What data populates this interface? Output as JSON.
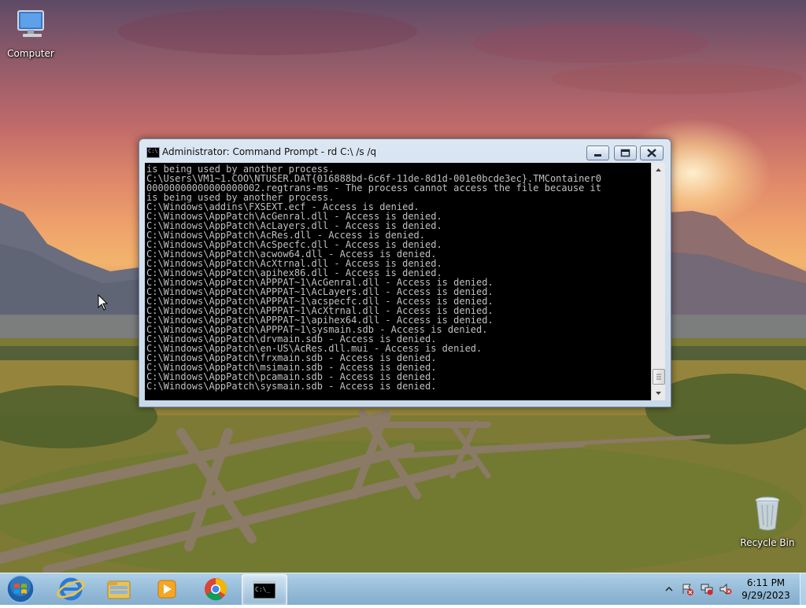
{
  "desktop": {
    "icons": [
      {
        "label": "Computer",
        "icon": "computer-icon"
      },
      {
        "label": "Recycle Bin",
        "icon": "recycle-bin-icon"
      }
    ]
  },
  "window": {
    "title": "Administrator:  Command Prompt - rd  C:\\ /s /q",
    "console_lines": [
      "is being used by another process.",
      "C:\\Users\\VM1~1.COO\\NTUSER.DAT{016888bd-6c6f-11de-8d1d-001e0bcde3ec}.TMContainer0",
      "00000000000000000002.regtrans-ms - The process cannot access the file because it",
      "is being used by another process.",
      "C:\\Windows\\addins\\FXSEXT.ecf - Access is denied.",
      "C:\\Windows\\AppPatch\\AcGenral.dll - Access is denied.",
      "C:\\Windows\\AppPatch\\AcLayers.dll - Access is denied.",
      "C:\\Windows\\AppPatch\\AcRes.dll - Access is denied.",
      "C:\\Windows\\AppPatch\\AcSpecfc.dll - Access is denied.",
      "C:\\Windows\\AppPatch\\acwow64.dll - Access is denied.",
      "C:\\Windows\\AppPatch\\AcXtrnal.dll - Access is denied.",
      "C:\\Windows\\AppPatch\\apihex86.dll - Access is denied.",
      "C:\\Windows\\AppPatch\\APPPAT~1\\AcGenral.dll - Access is denied.",
      "C:\\Windows\\AppPatch\\APPPAT~1\\AcLayers.dll - Access is denied.",
      "C:\\Windows\\AppPatch\\APPPAT~1\\acspecfc.dll - Access is denied.",
      "C:\\Windows\\AppPatch\\APPPAT~1\\AcXtrnal.dll - Access is denied.",
      "C:\\Windows\\AppPatch\\APPPAT~1\\apihex64.dll - Access is denied.",
      "C:\\Windows\\AppPatch\\APPPAT~1\\sysmain.sdb - Access is denied.",
      "C:\\Windows\\AppPatch\\drvmain.sdb - Access is denied.",
      "C:\\Windows\\AppPatch\\en-US\\AcRes.dll.mui - Access is denied.",
      "C:\\Windows\\AppPatch\\frxmain.sdb - Access is denied.",
      "C:\\Windows\\AppPatch\\msimain.sdb - Access is denied.",
      "C:\\Windows\\AppPatch\\pcamain.sdb - Access is denied.",
      "C:\\Windows\\AppPatch\\sysmain.sdb - Access is denied."
    ],
    "console_text_color": "#c0c0c0",
    "console_bg_color": "#000000"
  },
  "taskbar": {
    "buttons": [
      {
        "icon": "start-orb-icon"
      },
      {
        "icon": "internet-explorer-icon"
      },
      {
        "icon": "file-explorer-icon"
      },
      {
        "icon": "media-player-icon"
      },
      {
        "icon": "chrome-icon"
      },
      {
        "icon": "command-prompt-icon",
        "active": true,
        "glyph": "C:\\_"
      }
    ],
    "tray": {
      "icons": [
        "show-hidden-icons-icon",
        "action-center-icon",
        "network-icon",
        "volume-muted-icon"
      ],
      "time": "6:11 PM",
      "date": "9/29/2023"
    }
  },
  "colors": {
    "taskbar": "#9bbfdc",
    "window_frame": "#cddcee"
  }
}
